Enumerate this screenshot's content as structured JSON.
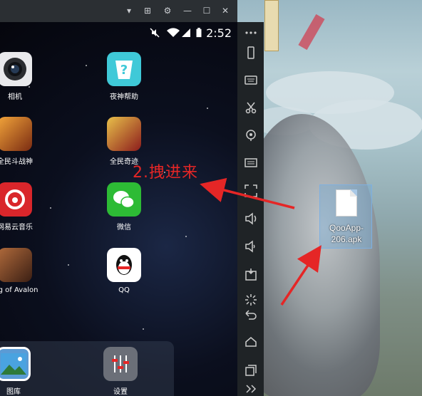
{
  "emulator": {
    "titlebar_buttons": [
      "▾",
      "⊞",
      "⚙",
      "—",
      "☐",
      "✕"
    ]
  },
  "statusbar": {
    "time": "2:52"
  },
  "apps": [
    {
      "label": "相机",
      "icon": "camera-icon"
    },
    {
      "label": "夜神帮助",
      "icon": "help-icon"
    },
    {
      "label": "全民斗战神",
      "icon": "game-icon"
    },
    {
      "label": "全民奇迹",
      "icon": "game-icon"
    },
    {
      "label": "网易云音乐",
      "icon": "music-icon"
    },
    {
      "label": "微信",
      "icon": "wechat-icon"
    },
    {
      "label": "ing of Avalon",
      "icon": "game-icon"
    },
    {
      "label": "QQ",
      "icon": "qq-icon"
    }
  ],
  "dock": [
    {
      "label": "图库",
      "icon": "gallery-icon"
    },
    {
      "label": "设置",
      "icon": "settings-icon"
    }
  ],
  "toolbar": [
    "more-icon",
    "rotate-icon",
    "keyboard-icon",
    "scissors-icon",
    "location-icon",
    "screen-icon",
    "fullscreen-icon",
    "volume-up-icon",
    "volume-down-icon",
    "apk-icon",
    "loading-icon",
    "back-icon",
    "home-icon",
    "recent-icon",
    "expand-icon"
  ],
  "desktop_file": {
    "label": "QooApp-206.apk"
  },
  "annotation": {
    "text": "2.拽进来"
  },
  "colors": {
    "annotation": "#e52626",
    "toolbar": "#1f2326"
  }
}
